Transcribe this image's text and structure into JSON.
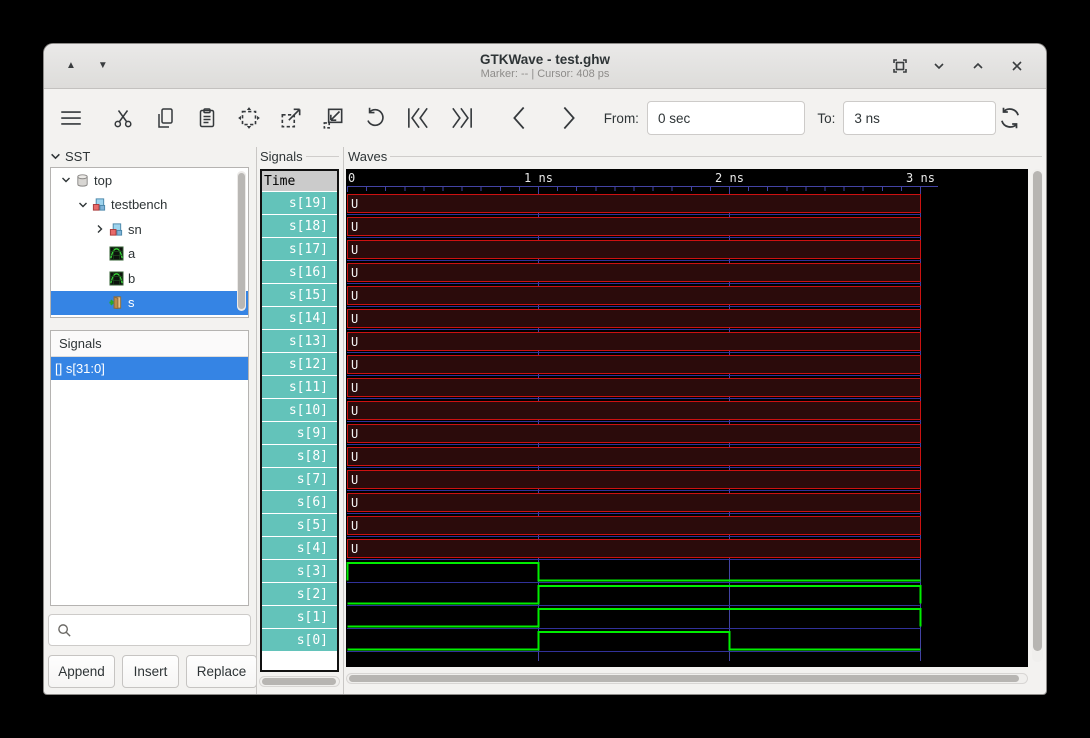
{
  "titlebar": {
    "title": "GTKWave - test.ghw",
    "status": "Marker: --  |  Cursor: 408 ps"
  },
  "toolbar": {
    "from_label": "From:",
    "from_value": "0 sec",
    "to_label": "To:",
    "to_value": "3 ns"
  },
  "sst": {
    "label": "SST",
    "tree": [
      {
        "label": "top",
        "icon": "component",
        "depth": 0,
        "expander": "expanded",
        "selected": false
      },
      {
        "label": "testbench",
        "icon": "module",
        "depth": 1,
        "expander": "expanded",
        "selected": false
      },
      {
        "label": "sn",
        "icon": "module",
        "depth": 2,
        "expander": "collapsed",
        "selected": false
      },
      {
        "label": "a",
        "icon": "wave",
        "depth": 2,
        "expander": "none",
        "selected": false
      },
      {
        "label": "b",
        "icon": "wave",
        "depth": 2,
        "expander": "none",
        "selected": false
      },
      {
        "label": "s",
        "icon": "port",
        "depth": 2,
        "expander": "none",
        "selected": true
      }
    ],
    "signals_header": "Signals",
    "signals_items": [
      {
        "label": "[] s[31:0]",
        "selected": true
      }
    ],
    "buttons": [
      "Append",
      "Insert",
      "Replace"
    ]
  },
  "names_panel": {
    "frame_label": "Signals",
    "time_header": "Time",
    "names": [
      "s[19]",
      "s[18]",
      "s[17]",
      "s[16]",
      "s[15]",
      "s[14]",
      "s[13]",
      "s[12]",
      "s[11]",
      "s[10]",
      "s[9]",
      "s[8]",
      "s[7]",
      "s[6]",
      "s[5]",
      "s[4]",
      "s[3]",
      "s[2]",
      "s[1]",
      "s[0]"
    ]
  },
  "waves": {
    "frame_label": "Waves",
    "timeline_labels": [
      "0",
      "1 ns",
      "2 ns",
      "3 ns"
    ],
    "time_start_ns": 0,
    "time_end_ns": 3,
    "rows": [
      {
        "name": "s[19]",
        "value": "U"
      },
      {
        "name": "s[18]",
        "value": "U"
      },
      {
        "name": "s[17]",
        "value": "U"
      },
      {
        "name": "s[16]",
        "value": "U"
      },
      {
        "name": "s[15]",
        "value": "U"
      },
      {
        "name": "s[14]",
        "value": "U"
      },
      {
        "name": "s[13]",
        "value": "U"
      },
      {
        "name": "s[12]",
        "value": "U"
      },
      {
        "name": "s[11]",
        "value": "U"
      },
      {
        "name": "s[10]",
        "value": "U"
      },
      {
        "name": "s[9]",
        "value": "U"
      },
      {
        "name": "s[8]",
        "value": "U"
      },
      {
        "name": "s[7]",
        "value": "U"
      },
      {
        "name": "s[6]",
        "value": "U"
      },
      {
        "name": "s[5]",
        "value": "U"
      },
      {
        "name": "s[4]",
        "value": "U"
      },
      {
        "name": "s[3]",
        "segments": [
          {
            "from": 0,
            "to": 1,
            "level": 1
          },
          {
            "from": 1,
            "to": 3,
            "level": 0
          }
        ]
      },
      {
        "name": "s[2]",
        "segments": [
          {
            "from": 0,
            "to": 1,
            "level": 0
          },
          {
            "from": 1,
            "to": 3,
            "level": 1
          }
        ]
      },
      {
        "name": "s[1]",
        "segments": [
          {
            "from": 0,
            "to": 1,
            "level": 0
          },
          {
            "from": 1,
            "to": 3,
            "level": 1
          }
        ]
      },
      {
        "name": "s[0]",
        "segments": [
          {
            "from": 0,
            "to": 1,
            "level": 0
          },
          {
            "from": 1,
            "to": 2,
            "level": 1
          },
          {
            "from": 2,
            "to": 3,
            "level": 0
          }
        ]
      }
    ]
  },
  "colors": {
    "selection": "#3584e4",
    "signal_cell": "#63c3ba",
    "time_header_bg": "#cbcbcb",
    "wave_bg": "#000000",
    "undef_fill": "#2b0b0b",
    "undef_border": "#cc1111",
    "wave_high_green": "#00ee00",
    "grid_blue": "#4343a4",
    "baseline_blue": "#31319a",
    "ruler_text": "#e8e8e8"
  }
}
